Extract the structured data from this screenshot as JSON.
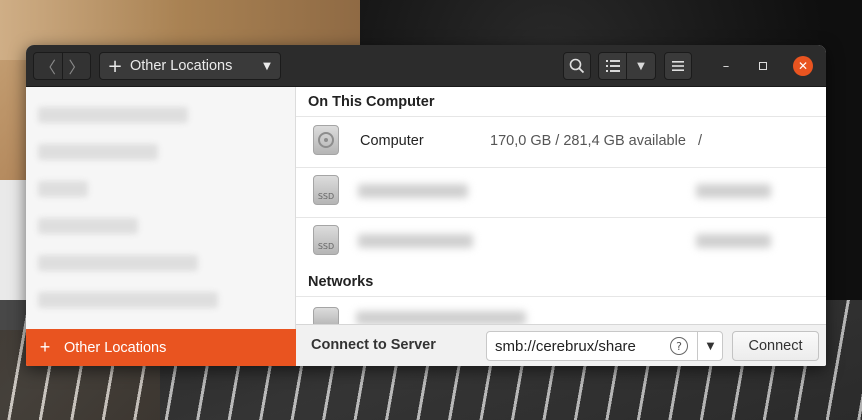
{
  "window": {
    "path_label": "Other Locations",
    "icons": {
      "back": "chevron-left-icon",
      "forward": "chevron-right-icon",
      "search": "search-icon",
      "view": "list-view-icon",
      "menu": "hamburger-menu-icon",
      "minimize": "minimize-icon",
      "maximize": "maximize-icon",
      "close": "close-icon"
    }
  },
  "sidebar": {
    "active_item": "Other Locations"
  },
  "on_this_computer": {
    "title": "On This Computer",
    "drives": [
      {
        "name": "Computer",
        "space": "170,0 GB / 281,4 GB available",
        "mount": "/",
        "icon": "hdd-icon"
      },
      {
        "name": "",
        "icon": "ssd-icon",
        "badge": "SSD"
      },
      {
        "name": "",
        "icon": "ssd-icon",
        "badge": "SSD"
      }
    ]
  },
  "networks": {
    "title": "Networks"
  },
  "connect": {
    "label": "Connect to Server",
    "server_value": "smb://cerebrux/share",
    "button": "Connect"
  },
  "colors": {
    "accent": "#e95420",
    "headerbar": "#2c2c2c"
  }
}
